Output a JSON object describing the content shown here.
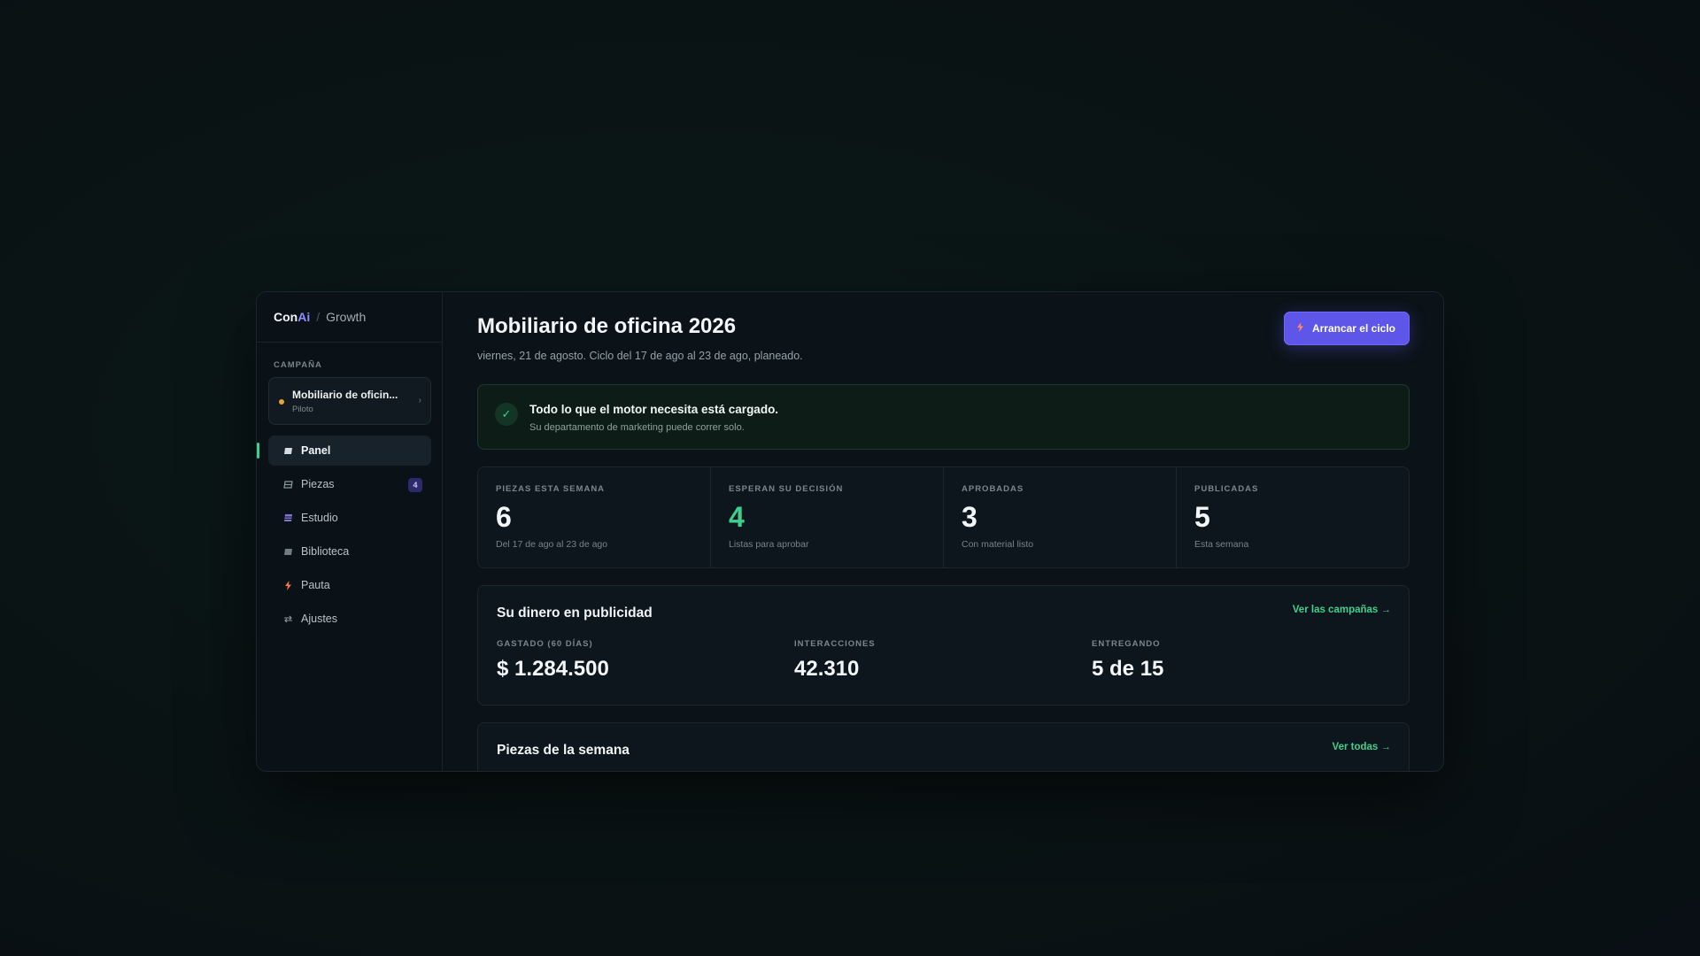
{
  "brand": {
    "logo_part1": "Con",
    "logo_part2": "Ai",
    "separator": "/",
    "product": "Growth"
  },
  "sidebar": {
    "section_label": "CAMPAÑA",
    "campaign": {
      "name": "Mobiliario de oficin...",
      "status": "Piloto",
      "status_color": "#e9a23b"
    },
    "items": [
      {
        "label": "Panel",
        "icon": "panel-icon",
        "active": true
      },
      {
        "label": "Piezas",
        "icon": "pieces-icon",
        "badge": "4"
      },
      {
        "label": "Estudio",
        "icon": "studio-icon"
      },
      {
        "label": "Biblioteca",
        "icon": "library-icon"
      },
      {
        "label": "Pauta",
        "icon": "bolt-icon"
      },
      {
        "label": "Ajustes",
        "icon": "settings-icon"
      }
    ]
  },
  "header": {
    "title": "Mobiliario de oficina 2026",
    "subtitle": "viernes, 21 de agosto. Ciclo del 17 de ago al 23 de ago, planeado.",
    "cta_label": "Arrancar el ciclo",
    "cta_icon": "bolt-icon",
    "accent_color": "#5e56e8"
  },
  "alert": {
    "icon": "check-icon",
    "title": "Todo lo que el motor necesita está cargado.",
    "subtitle": "Su departamento de marketing puede correr solo."
  },
  "stats": [
    {
      "label": "PIEZAS ESTA SEMANA",
      "value": "6",
      "sub": "Del 17 de ago al 23 de ago"
    },
    {
      "label": "ESPERAN SU DECISIÓN",
      "value": "4",
      "sub": "Listas para aprobar",
      "highlight": true
    },
    {
      "label": "APROBADAS",
      "value": "3",
      "sub": "Con material listo"
    },
    {
      "label": "PUBLICADAS",
      "value": "5",
      "sub": "Esta semana"
    }
  ],
  "money": {
    "title": "Su dinero en publicidad",
    "link": "Ver las campañas →",
    "metrics": [
      {
        "label": "GASTADO (60 DÍAS)",
        "value": "$ 1.284.500"
      },
      {
        "label": "INTERACCIONES",
        "value": "42.310"
      },
      {
        "label": "ENTREGANDO",
        "value": "5 de 15"
      }
    ]
  },
  "pieces": {
    "title": "Piezas de la semana",
    "link": "Ver todas →"
  },
  "colors": {
    "green_accent": "#3ecf8e",
    "active_indicator": "#3ecf8e"
  }
}
